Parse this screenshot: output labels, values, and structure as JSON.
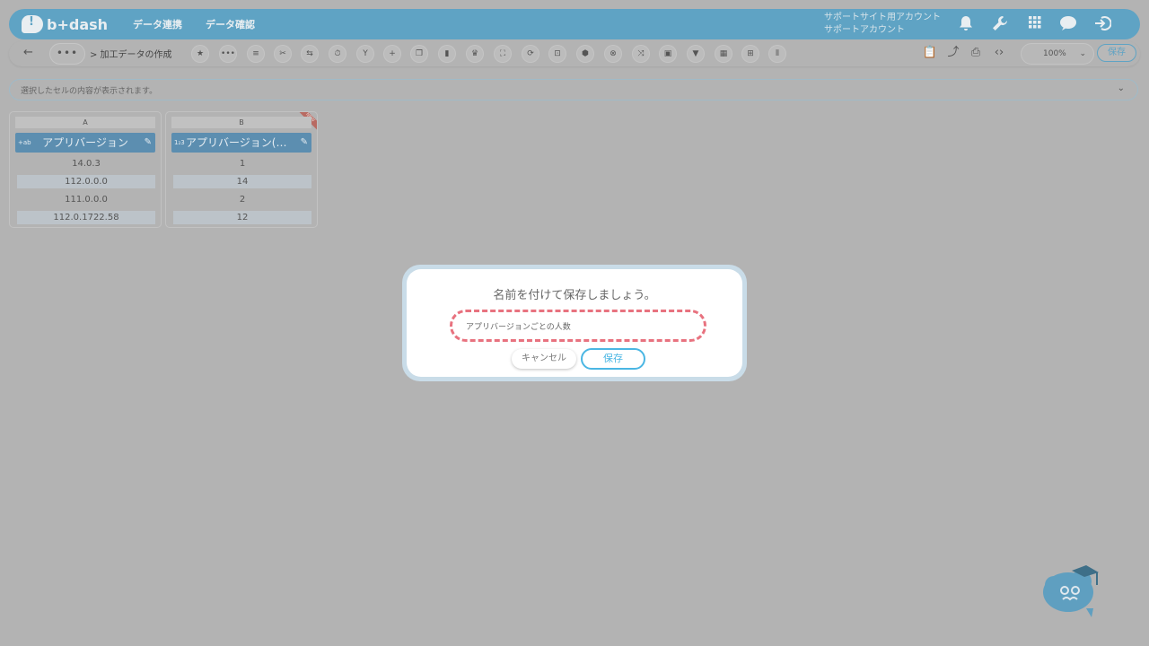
{
  "header": {
    "logo_text": "b+dash",
    "nav": [
      "データ連携",
      "データ確認"
    ],
    "account_line1": "サポートサイト用アカウント",
    "account_line2": "サポートアカウント"
  },
  "toolbar": {
    "more": "•••",
    "breadcrumb": "> 加工データの作成",
    "zoom": "100%",
    "save_label": "保存"
  },
  "cellbar": {
    "placeholder": "選択したセルの内容が表示されます。"
  },
  "columns": [
    {
      "letter": "A",
      "type_icon": "+ab",
      "title": "アプリバージョン",
      "cells": [
        "14.0.3",
        "112.0.0.0",
        "111.0.0.0",
        "112.0.1722.58"
      ],
      "is_new": false
    },
    {
      "letter": "B",
      "type_icon": "1₂3",
      "title": "アプリバージョン(…",
      "cells": [
        "1",
        "14",
        "2",
        "12"
      ],
      "is_new": true,
      "new_label": "NEW"
    }
  ],
  "modal": {
    "title": "名前を付けて保存しましょう。",
    "name_value": "アプリバージョンごとの人数",
    "cancel_label": "キャンセル",
    "save_label": "保存"
  },
  "colors": {
    "header_blue": "#5fa3c4",
    "column_head": "#5c8eb0",
    "accent_save": "#4ab6e3",
    "dashed_highlight": "#e8727f"
  }
}
